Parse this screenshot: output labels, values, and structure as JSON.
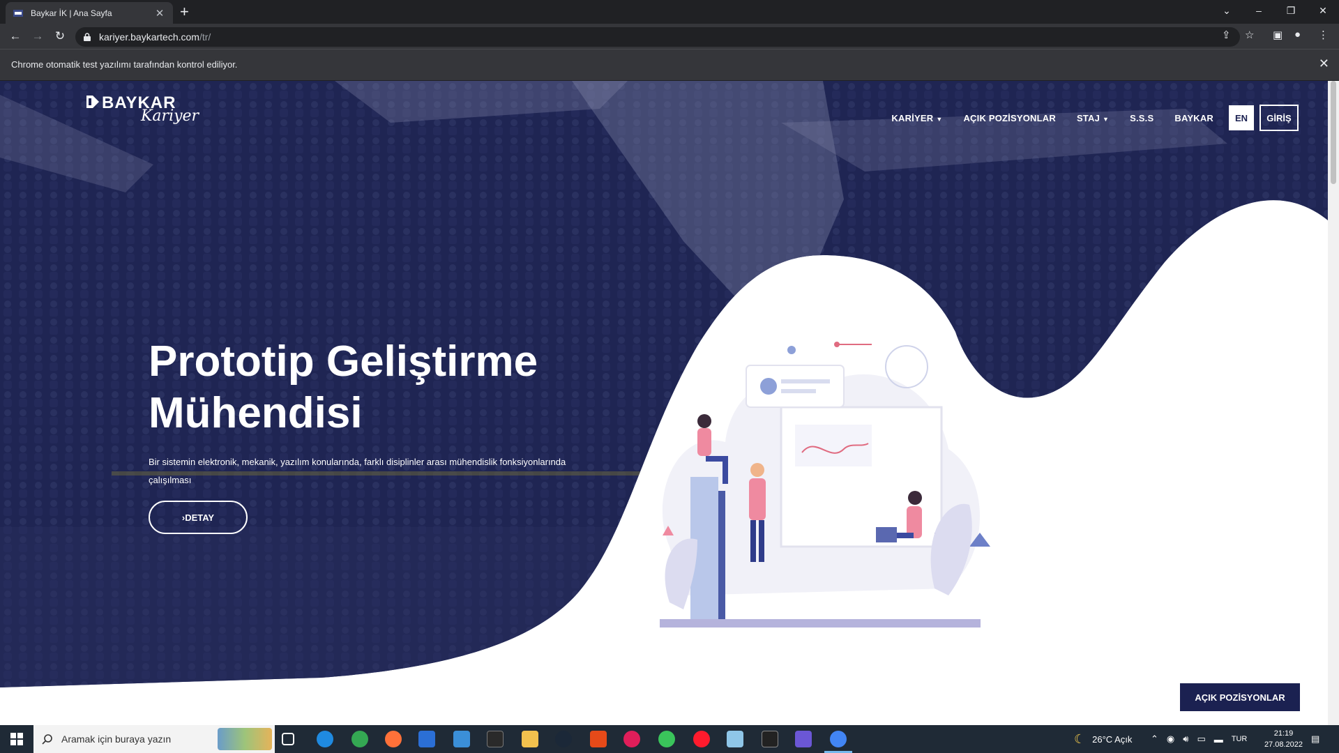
{
  "browser": {
    "tab_title": "Baykar İK | Ana Sayfa",
    "url_host": "kariyer.baykartech.com",
    "url_path": "/tr/",
    "infobar_message": "Chrome otomatik test yazılımı tarafından kontrol ediliyor."
  },
  "site": {
    "logo_text": "BAYKAR",
    "logo_script": "Kariyer",
    "nav": {
      "kariyer": "KARİYER",
      "acik_pozisyonlar": "AÇIK POZİSYONLAR",
      "staj": "STAJ",
      "sss": "S.S.S",
      "baykar": "BAYKAR",
      "lang": "EN",
      "login": "GİRİŞ"
    },
    "hero": {
      "title": "Prototip Geliştirme Mühendisi",
      "description": "Bir sistemin elektronik, mekanik, yazılım konularında, farklı disiplinler arası mühendislik fonksiyonlarında çalışılması",
      "cta": "›DETAY"
    },
    "floating_button": "AÇIK POZİSYONLAR"
  },
  "taskbar": {
    "search_placeholder": "Aramak için buraya yazın",
    "weather": "26°C  Açık",
    "language": "TUR",
    "time": "21:19",
    "date": "27.08.2022"
  },
  "colors": {
    "hero_overlay": "#1b2151",
    "brand_navy": "#1b2151",
    "chrome_dark": "#202124",
    "chrome_mid": "#35363a",
    "taskbar": "#1f2a36"
  }
}
